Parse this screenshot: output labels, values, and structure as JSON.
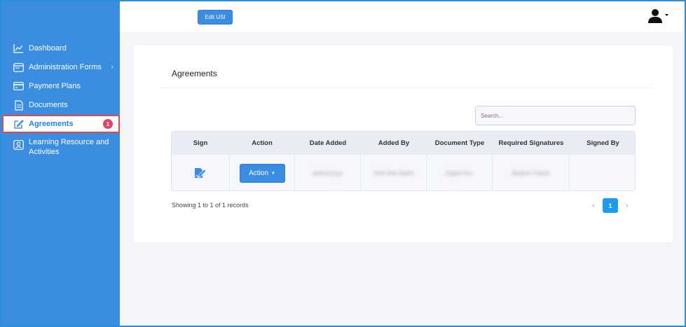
{
  "sidebar": {
    "items": [
      {
        "label": "Dashboard",
        "icon": "chart-line-icon"
      },
      {
        "label": "Administration Forms",
        "icon": "browser-window-icon",
        "has_submenu": true
      },
      {
        "label": "Payment Plans",
        "icon": "credit-card-icon"
      },
      {
        "label": "Documents",
        "icon": "document-icon"
      },
      {
        "label": "Agreements",
        "icon": "edit-icon",
        "active": true,
        "badge": "1"
      },
      {
        "label": "Learning Resource and Activities",
        "icon": "person-card-icon"
      }
    ]
  },
  "header": {
    "edit_usi_label": "Edit USI",
    "user_icon": "user-icon"
  },
  "main": {
    "title": "Agreements",
    "search_placeholder": "Search...",
    "table": {
      "columns": [
        "Sign",
        "Action",
        "Date Added",
        "Added By",
        "Document Type",
        "Required Signatures",
        "Signed By"
      ],
      "rows": [
        {
          "sign_icon": "sign-document-icon",
          "action_label": "Action",
          "date_added": "dd/mm/yyyy",
          "added_by": "John Doe Name",
          "document_type": "Digital Doc",
          "required_signatures": "Student Trainer",
          "signed_by": ""
        }
      ]
    },
    "records_text": "Showing 1 to 1 of 1 records",
    "pagination": {
      "prev": "‹",
      "current": "1",
      "next": "›"
    }
  },
  "colors": {
    "sidebar_bg": "#3b8de2",
    "accent": "#3b8de2",
    "badge": "#e0446a",
    "active_outline": "#e04a4a",
    "page_button": "#1e9bf0"
  }
}
